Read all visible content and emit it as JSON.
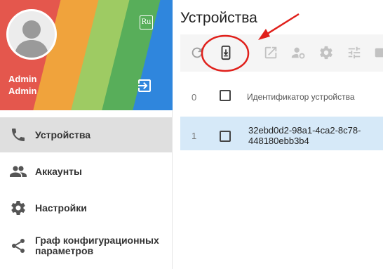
{
  "profile": {
    "first_name": "Admin",
    "last_name": "Admin",
    "lang_label": "Ru"
  },
  "nav": {
    "items": [
      {
        "label": "Устройства",
        "icon": "phone-icon",
        "active": true
      },
      {
        "label": "Аккаунты",
        "icon": "people-icon"
      },
      {
        "label": "Настройки",
        "icon": "gear-icon"
      },
      {
        "label": "Граф конфигурационных параметров",
        "icon": "share-icon"
      }
    ]
  },
  "page": {
    "title": "Устройства"
  },
  "toolbar": {
    "buttons": [
      "refresh-icon",
      "device-download-icon",
      "open-external-icon",
      "person-settings-icon",
      "gear-icon",
      "tune-icon",
      "label-icon"
    ]
  },
  "table": {
    "header": {
      "num": "0",
      "column": "Идентификатор устройства"
    },
    "rows": [
      {
        "num": "1",
        "id": "32ebd0d2-98a1-4ca2-8c78-448180ebb3b4",
        "selected": true
      }
    ]
  },
  "colors": {
    "accent_selected_row": "#d6e9f8",
    "annotation_red": "#e0201b"
  }
}
